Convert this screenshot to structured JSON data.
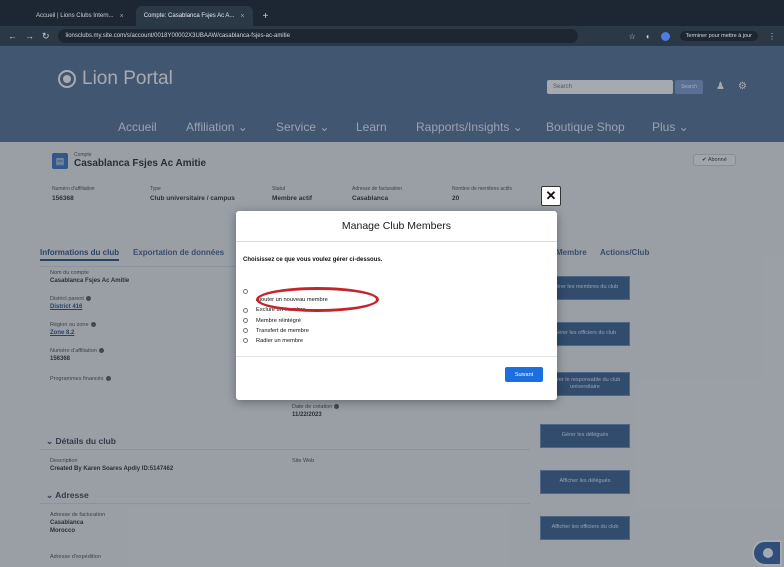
{
  "browser": {
    "tabs": [
      {
        "title": "Accueil | Lions Clubs Intern...",
        "close": "×"
      },
      {
        "title": "Compte: Casablanca Fsjes Ac A...",
        "close": "×"
      }
    ],
    "new_tab": "+",
    "url": "lionsclubs.my.site.com/s/account/0018Y00002X3UBAAW/casablanca-fsjes-ac-amitie",
    "profile_label": "Terminer pour mettre à jour"
  },
  "portal": {
    "logo_text": "Lion Portal",
    "search_placeholder": "Search",
    "search_button": "Search",
    "nav": [
      "Accueil",
      "Affiliation ⌄",
      "Service ⌄",
      "Learn",
      "Rapports/Insights ⌄",
      "Boutique Shop",
      "Plus ⌄"
    ]
  },
  "record": {
    "type": "Compte",
    "title": "Casablanca Fsjes Ac Amitie",
    "follow": "✔ Abonné",
    "facts": [
      {
        "label": "Numéro d'affiliation",
        "value": "156368"
      },
      {
        "label": "Type",
        "value": "Club universitaire / campus"
      },
      {
        "label": "Statut",
        "value": "Membre actif"
      },
      {
        "label": "Adresse de facturation",
        "value": "Casablanca"
      },
      {
        "label": "Nombre de membres actifs",
        "value": "20"
      }
    ]
  },
  "tabs": [
    "Informations du club",
    "Exportation de données",
    "Membre",
    "Actions/Club"
  ],
  "left_fields": [
    {
      "label": "Nom du compte",
      "value": "Casablanca Fsjes Ac Amitie"
    },
    {
      "label": "District parent",
      "value": "District 416"
    },
    {
      "label": "Région ou zone",
      "value": "Zone 8.2"
    },
    {
      "label": "Numéro d'affiliation",
      "value": "156368"
    },
    {
      "label": "Programmes financés",
      "value": ""
    }
  ],
  "creation": {
    "label": "Date de création",
    "value": "11/22/2023"
  },
  "details": {
    "heading": "⌄ Détails du club",
    "desc_label": "Description",
    "desc_value": "Created By Karen Soares Apdiy ID:5147462",
    "site_label": "Site Web"
  },
  "address": {
    "heading": "⌄ Adresse",
    "billing_label": "Adresse de facturation",
    "billing_line1": "Casablanca",
    "billing_line2": "Morocco",
    "shipping_label": "Adresse d'expédition"
  },
  "actions": [
    "Gérer les membres du club",
    "Gérer les officiers du club",
    "Gérer le responsable du club universitaire",
    "Gérer les délégués",
    "Afficher les délégués",
    "Afficher les officiers du club"
  ],
  "modal": {
    "title": "Manage Club Members",
    "close": "✕",
    "prompt": "Choisissez ce que vous voulez gérer ci-dessous.",
    "options": [
      "Ajouter un nouveau membre",
      "Exclure un membre",
      "Membre réintégré",
      "Transfert de membre",
      "Radier un membre"
    ],
    "submit": "Suivant"
  }
}
